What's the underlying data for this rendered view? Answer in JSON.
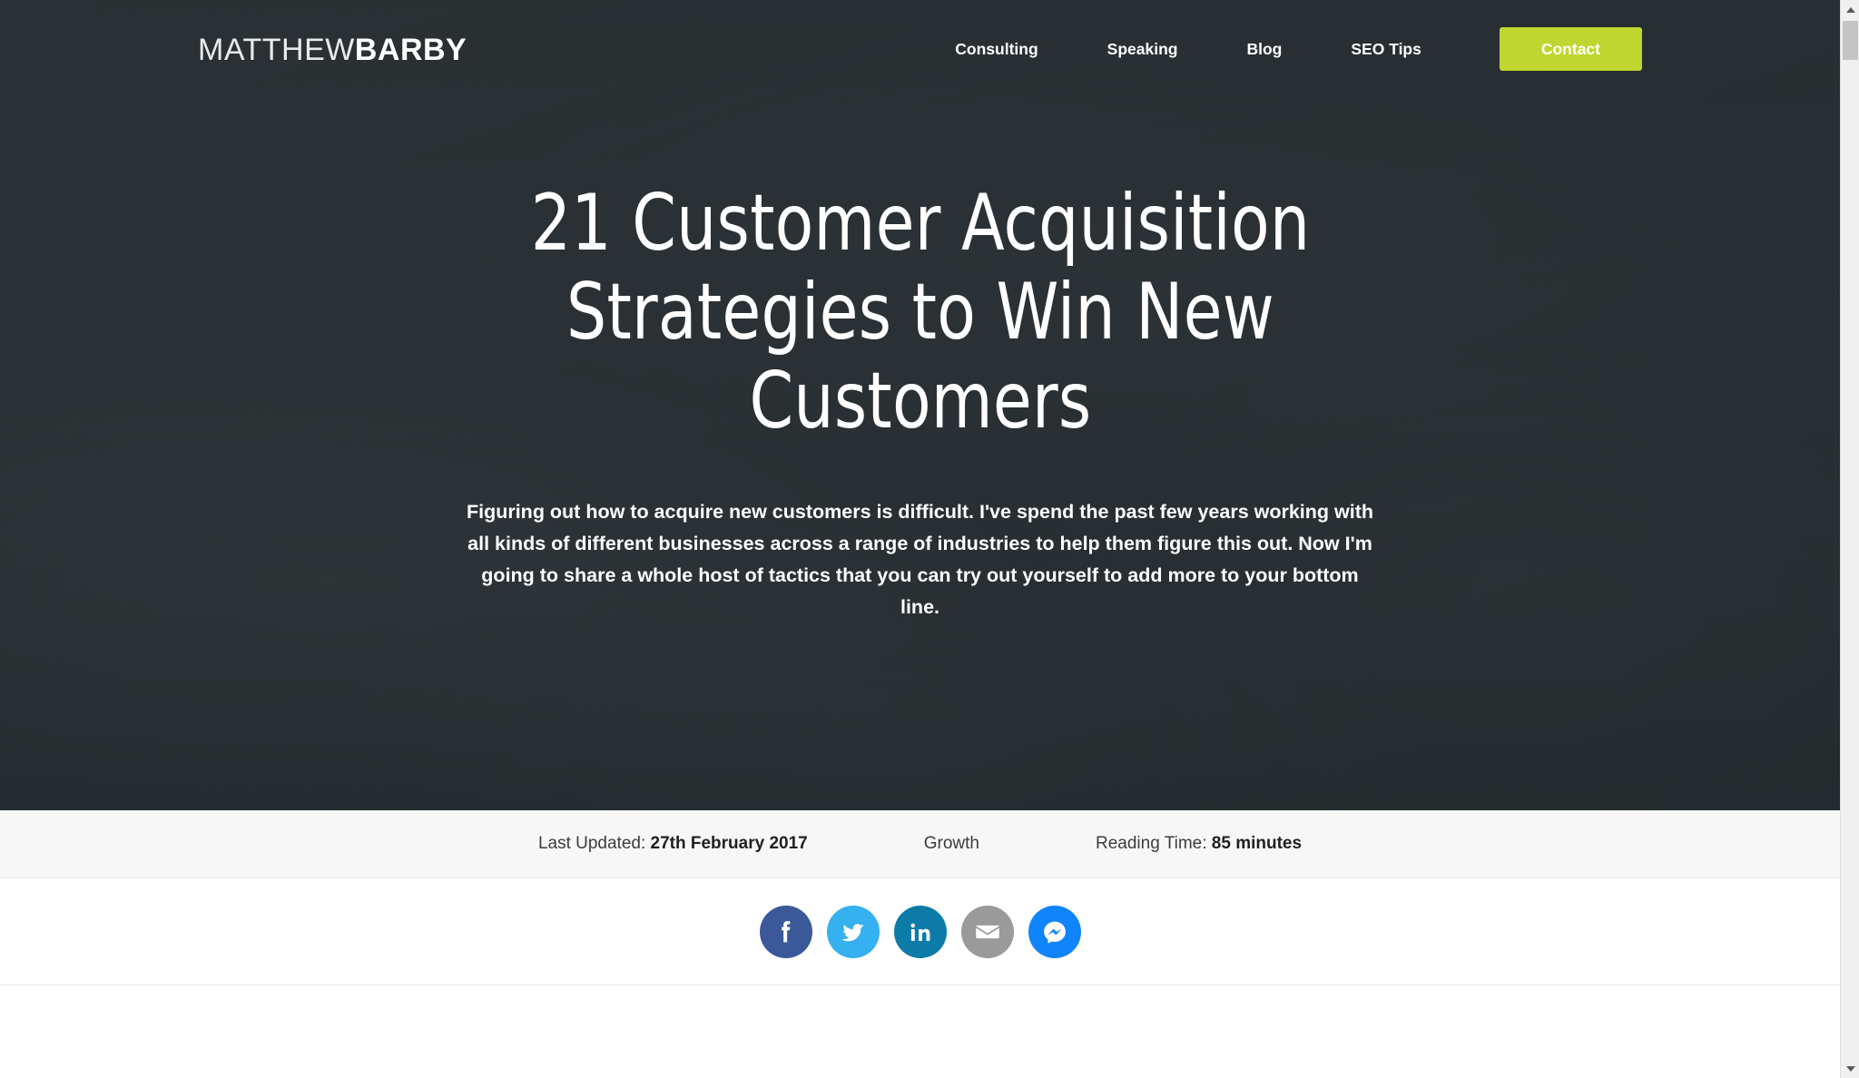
{
  "brand": {
    "logo_light": "MATTHEW",
    "logo_bold": "BARBY",
    "accent_color": "#bed62f",
    "hero_background_color": "#2b3134"
  },
  "nav": {
    "items": [
      {
        "label": "Consulting"
      },
      {
        "label": "Speaking"
      },
      {
        "label": "Blog"
      },
      {
        "label": "SEO Tips"
      }
    ],
    "cta": {
      "label": "Contact"
    }
  },
  "hero": {
    "title": "21 Customer Acquisition Strategies to Win New Customers",
    "subtitle": "Figuring out how to acquire new customers is difficult. I've spend the past few years working with all kinds of different businesses across a range of industries to help them figure this out. Now I'm going to share a whole host of tactics that you can try out yourself to add more to your bottom line."
  },
  "meta": {
    "last_updated_label": "Last Updated:",
    "last_updated_value": "27th February 2017",
    "category": "Growth",
    "reading_time_label": "Reading Time:",
    "reading_time_value": "85 minutes"
  },
  "share": {
    "buttons": [
      {
        "name": "facebook",
        "label": "Share on Facebook",
        "color": "#3b5998"
      },
      {
        "name": "twitter",
        "label": "Share on Twitter",
        "color": "#35b1ef"
      },
      {
        "name": "linkedin",
        "label": "Share on LinkedIn",
        "color": "#0d7ba8"
      },
      {
        "name": "email",
        "label": "Share by Email",
        "color": "#9a9a9a"
      },
      {
        "name": "messenger",
        "label": "Share on Messenger",
        "color": "#0f84fb"
      }
    ]
  },
  "scrollbar": {
    "up_arrow": "▲",
    "down_arrow": "▼"
  }
}
